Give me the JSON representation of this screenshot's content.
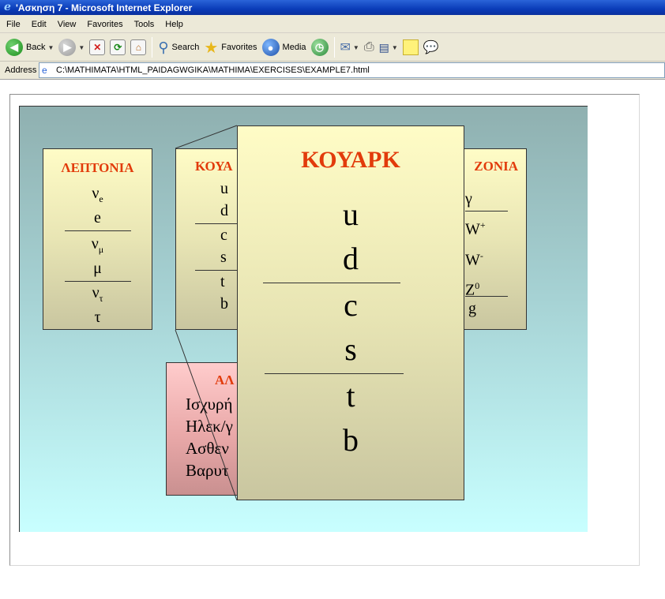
{
  "window": {
    "title": "'Ασκηση 7 - Microsoft Internet Explorer"
  },
  "menu": [
    "File",
    "Edit",
    "View",
    "Favorites",
    "Tools",
    "Help"
  ],
  "toolbar": {
    "back": "Back",
    "search": "Search",
    "favorites": "Favorites",
    "media": "Media"
  },
  "address": {
    "label": "Address",
    "url": "C:\\MATHIMATA\\HTML_PAIDAGWGIKA\\MATHIMA\\EXERCISES\\EXAMPLE7.html"
  },
  "page": {
    "leptons": {
      "title": "ΛΕΠΤΟΝΙΑ",
      "groups": [
        [
          {
            "base": "ν",
            "sub": "e"
          },
          {
            "base": "e",
            "sub": ""
          }
        ],
        [
          {
            "base": "ν",
            "sub": "μ"
          },
          {
            "base": "μ",
            "sub": ""
          }
        ],
        [
          {
            "base": "ν",
            "sub": "τ"
          },
          {
            "base": "τ",
            "sub": ""
          }
        ]
      ]
    },
    "quarks_small": {
      "title_visible": "ΚΟΥΑ",
      "items": [
        "u",
        "d",
        "c",
        "s",
        "t",
        "b"
      ]
    },
    "bosons": {
      "title_visible": "ΖΟΝΙΑ",
      "items": [
        {
          "base": "γ",
          "sup": ""
        },
        {
          "base": "W",
          "sup": "+"
        },
        {
          "base": "W",
          "sup": "-"
        },
        {
          "base": "Z",
          "sup": "0"
        },
        {
          "base": "g",
          "sup": ""
        }
      ]
    },
    "interactions": {
      "title_visible": "ΑΛ",
      "lines": [
        "Ισχυρή",
        "Ηλεκ/γ",
        "Ασθεν",
        "Βαρυτ"
      ]
    },
    "quarks_zoom": {
      "title": "ΚΟΥΑΡΚ",
      "items": [
        "u",
        "d",
        "c",
        "s",
        "t",
        "b"
      ]
    },
    "colors": {
      "title_red": "#e23b0b",
      "card_top": "#fffcc6",
      "card_bottom": "#c9c6a0",
      "stage_top": "#8fb0b0",
      "stage_bottom": "#c8ffff"
    }
  }
}
